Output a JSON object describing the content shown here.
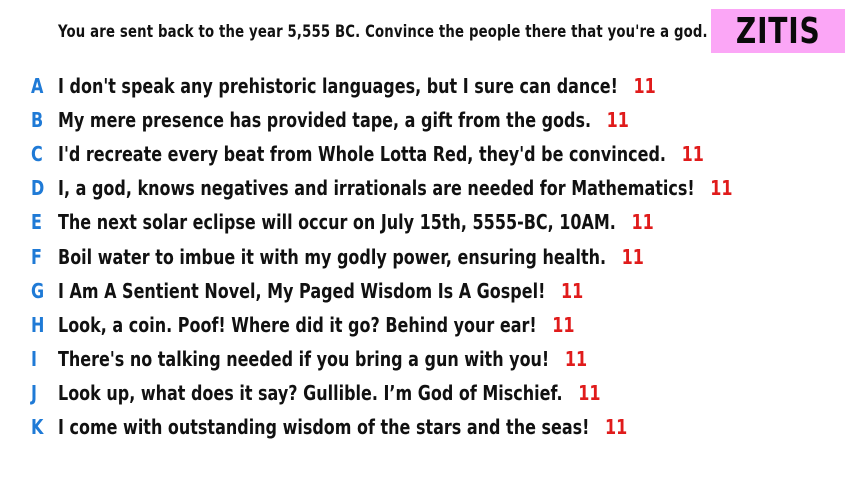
{
  "prompt": "You are sent back to the year 5,555 BC. Convince the people there that you're a god.",
  "team_badge": {
    "label": "ZITIS",
    "color": "#fba6f6"
  },
  "colors": {
    "letter": "#1f7ad6",
    "score": "#e01b1b",
    "text": "#111111"
  },
  "answers": [
    {
      "letter": "A",
      "text": "I don't speak any prehistoric languages, but I sure can dance!",
      "score": "11"
    },
    {
      "letter": "B",
      "text": "My mere presence has provided tape, a gift from the gods.",
      "score": "11"
    },
    {
      "letter": "C",
      "text": "I'd recreate every beat from Whole Lotta Red, they'd be convinced.",
      "score": "11"
    },
    {
      "letter": "D",
      "text": "I, a god, knows negatives and irrationals are needed for Mathematics!",
      "score": "11"
    },
    {
      "letter": "E",
      "text": "The next solar eclipse will occur on July 15th, 5555-BC, 10AM.",
      "score": "11"
    },
    {
      "letter": "F",
      "text": "Boil water to imbue it with my godly power, ensuring health.",
      "score": "11"
    },
    {
      "letter": "G",
      "text": "I Am A Sentient Novel, My Paged Wisdom Is A Gospel!",
      "score": "11"
    },
    {
      "letter": "H",
      "text": "Look, a coin. Poof! Where did it go? Behind your ear!",
      "score": "11"
    },
    {
      "letter": "I",
      "text": "There's no talking needed if you bring a gun with you!",
      "score": "11"
    },
    {
      "letter": "J",
      "text": "Look up, what does it say? Gullible. I’m God of Mischief.",
      "score": "11"
    },
    {
      "letter": "K",
      "text": "I come with outstanding wisdom of the stars and the seas!",
      "score": "11"
    }
  ]
}
